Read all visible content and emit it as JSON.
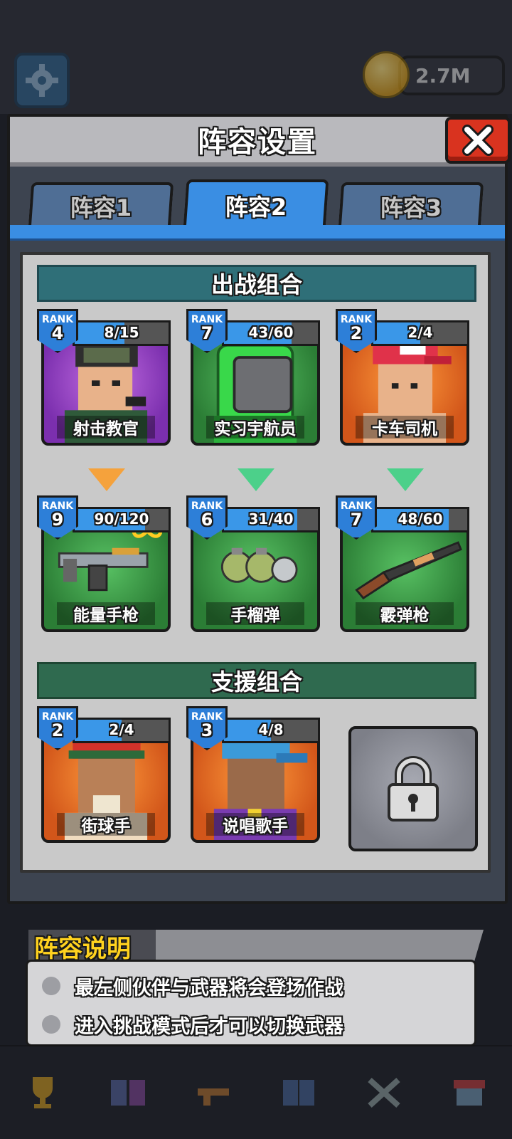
{
  "topbar": {
    "coins": "2.7M"
  },
  "modal": {
    "title": "阵容设置",
    "tabs": [
      {
        "label": "阵容1",
        "active": false
      },
      {
        "label": "阵容2",
        "active": true
      },
      {
        "label": "阵容3",
        "active": false
      }
    ]
  },
  "battle_section": {
    "title": "出战组合",
    "partners": [
      {
        "rank_word": "RANK",
        "rank": "4",
        "count": "8/15",
        "progress": 0.53,
        "name": "射击教官",
        "bg": "purple",
        "arrow": "orange"
      },
      {
        "rank_word": "RANK",
        "rank": "7",
        "count": "43/60",
        "progress": 0.72,
        "name": "实习宇航员",
        "bg": "green",
        "arrow": "green"
      },
      {
        "rank_word": "RANK",
        "rank": "2",
        "count": "2/4",
        "progress": 0.5,
        "name": "卡车司机",
        "bg": "orange",
        "arrow": "green"
      }
    ],
    "weapons": [
      {
        "rank_word": "RANK",
        "rank": "9",
        "count": "90/120",
        "progress": 0.75,
        "name": "能量手枪",
        "bg": "green",
        "infinite": true
      },
      {
        "rank_word": "RANK",
        "rank": "6",
        "count": "31/40",
        "progress": 0.78,
        "name": "手榴弹",
        "bg": "green"
      },
      {
        "rank_word": "RANK",
        "rank": "7",
        "count": "48/60",
        "progress": 0.8,
        "name": "霰弹枪",
        "bg": "green"
      }
    ]
  },
  "support_section": {
    "title": "支援组合",
    "partners": [
      {
        "rank_word": "RANK",
        "rank": "2",
        "count": "2/4",
        "progress": 0.5,
        "name": "街球手",
        "bg": "orange"
      },
      {
        "rank_word": "RANK",
        "rank": "3",
        "count": "4/8",
        "progress": 0.5,
        "name": "说唱歌手",
        "bg": "orange"
      }
    ],
    "locked_slot": "lock-icon"
  },
  "explanation": {
    "title": "阵容说明",
    "lines": [
      "最左侧伙伴与武器将会登场作战",
      "进入挑战模式后才可以切换武器"
    ]
  },
  "bottom_nav": [
    "trophy-icon",
    "team-icon",
    "weapon-icon",
    "book-icon",
    "battle-icon",
    "shop-icon"
  ],
  "colors": {
    "accent_blue": "#3a8ee3",
    "close_red": "#d9331f",
    "title_yellow": "#ffd21f"
  }
}
